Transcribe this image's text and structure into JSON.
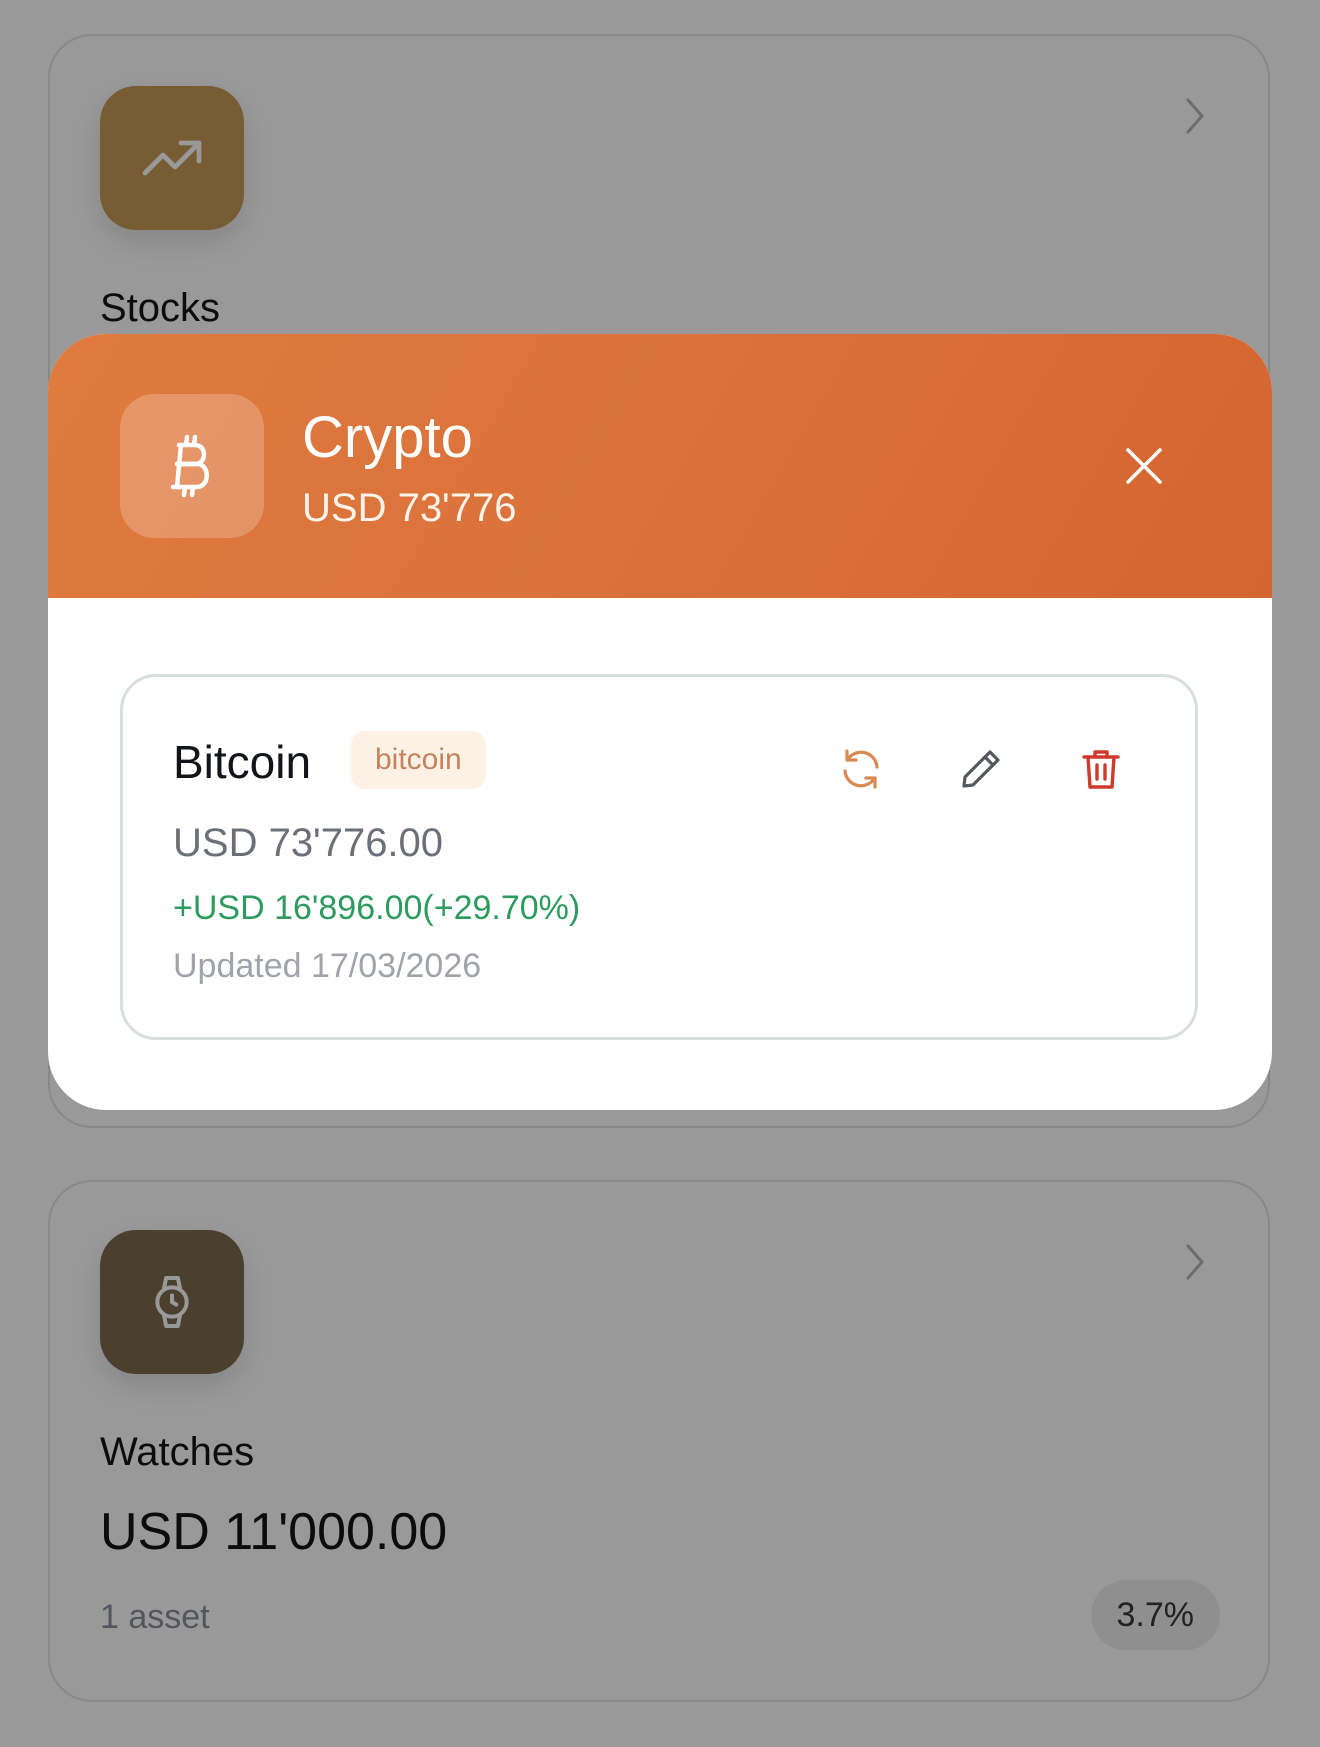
{
  "categories": {
    "stocks": {
      "title": "Stocks",
      "icon": "trending-up-icon",
      "icon_color": "#7a5b34"
    },
    "watches": {
      "title": "Watches",
      "value": "USD 11'000.00",
      "asset_count": "1 asset",
      "share": "3.7%",
      "icon": "watch-icon",
      "icon_color": "#4c3d2b"
    }
  },
  "modal": {
    "title": "Crypto",
    "total": "USD 73'776",
    "icon": "bitcoin-icon",
    "header_color": "#dc7438",
    "close_icon": "close-icon",
    "asset": {
      "name": "Bitcoin",
      "tag": "bitcoin",
      "value": "USD 73'776.00",
      "change": "+USD 16'896.00(+29.70%)",
      "updated": "Updated 17/03/2026",
      "actions": [
        "refresh-icon",
        "edit-icon",
        "delete-icon"
      ]
    }
  },
  "colors": {
    "positive": "#2e9b5e",
    "delete": "#d0392b",
    "refresh": "#d98a52"
  }
}
